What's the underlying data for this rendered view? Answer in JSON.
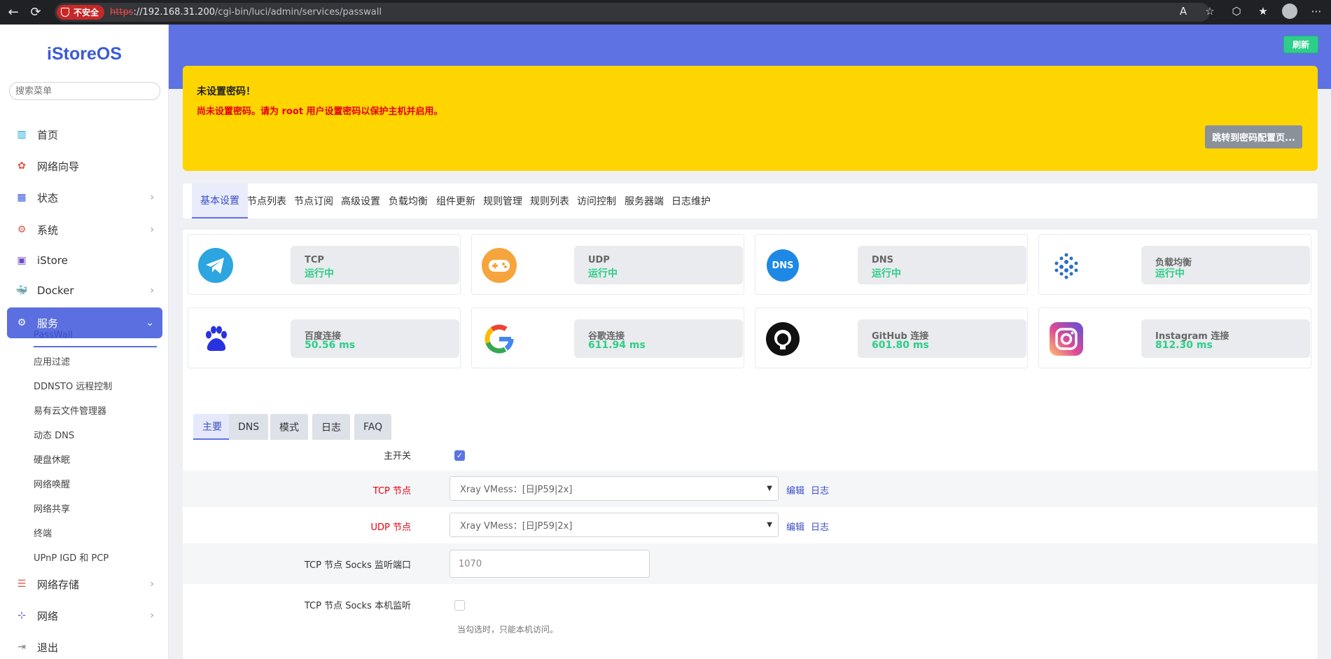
{
  "browser": {
    "insecure_label": "不安全",
    "url_proto": "https",
    "url_host": "://192.168.31.200",
    "url_path": "/cgi-bin/luci/admin/services/passwall"
  },
  "sidebar": {
    "logo": "iStoreOS",
    "search_placeholder": "搜索菜单",
    "items": [
      {
        "label": "首页"
      },
      {
        "label": "网络向导"
      },
      {
        "label": "状态"
      },
      {
        "label": "系统"
      },
      {
        "label": "iStore"
      },
      {
        "label": "Docker"
      },
      {
        "label": "服务"
      },
      {
        "label": "网络存储"
      },
      {
        "label": "网络"
      },
      {
        "label": "退出"
      }
    ],
    "sub_items": [
      {
        "label": "PassWall"
      },
      {
        "label": "应用过滤"
      },
      {
        "label": "DDNSTO 远程控制"
      },
      {
        "label": "易有云文件管理器"
      },
      {
        "label": "动态 DNS"
      },
      {
        "label": "硬盘休眠"
      },
      {
        "label": "网络唤醒"
      },
      {
        "label": "网络共享"
      },
      {
        "label": "终端"
      },
      {
        "label": "UPnP IGD 和 PCP"
      }
    ]
  },
  "header": {
    "refresh_label": "刷新"
  },
  "alert": {
    "title": "未设置密码！",
    "message": "尚未设置密码。请为 root 用户设置密码以保护主机并启用。",
    "button": "跳转到密码配置页..."
  },
  "tabs": [
    {
      "label": "基本设置"
    },
    {
      "label": "节点列表"
    },
    {
      "label": "节点订阅"
    },
    {
      "label": "高级设置"
    },
    {
      "label": "负载均衡"
    },
    {
      "label": "组件更新"
    },
    {
      "label": "规则管理"
    },
    {
      "label": "规则列表"
    },
    {
      "label": "访问控制"
    },
    {
      "label": "服务器端"
    },
    {
      "label": "日志维护"
    }
  ],
  "status": [
    {
      "label": "TCP",
      "value": "运行中",
      "icon": "telegram-icon"
    },
    {
      "label": "UDP",
      "value": "运行中",
      "icon": "gamepad-icon"
    },
    {
      "label": "DNS",
      "value": "运行中",
      "icon": "dns-icon",
      "icon_text": "DNS"
    },
    {
      "label": "负载均衡",
      "value": "运行中",
      "icon": "load-balance-icon"
    },
    {
      "label": "百度连接",
      "value": "50.56 ms",
      "icon": "baidu-icon"
    },
    {
      "label": "谷歌连接",
      "value": "611.94 ms",
      "icon": "google-icon"
    },
    {
      "label": "GitHub 连接",
      "value": "601.80 ms",
      "icon": "github-icon"
    },
    {
      "label": "Instagram 连接",
      "value": "812.30 ms",
      "icon": "instagram-icon"
    }
  ],
  "form_tabs": [
    {
      "label": "主要"
    },
    {
      "label": "DNS"
    },
    {
      "label": "模式"
    },
    {
      "label": "日志"
    },
    {
      "label": "FAQ"
    }
  ],
  "form": {
    "main_switch_label": "主开关",
    "tcp_node_label": "TCP 节点",
    "tcp_node_value": "Xray VMess：[日JP59|2x]",
    "udp_node_label": "UDP 节点",
    "udp_node_value": "Xray VMess：[日JP59|2x]",
    "edit_label": "编辑",
    "log_label": "日志",
    "socks_port_label": "TCP 节点 Socks 监听端口",
    "socks_port_placeholder": "1070",
    "socks_local_label": "TCP 节点 Socks 本机监听",
    "socks_local_hint": "当勾选时，只能本机访问。"
  },
  "colors": {
    "accent": "#5e72e4",
    "alert_bg": "#ffd500",
    "success": "#2dce89",
    "error": "#e3000f"
  }
}
